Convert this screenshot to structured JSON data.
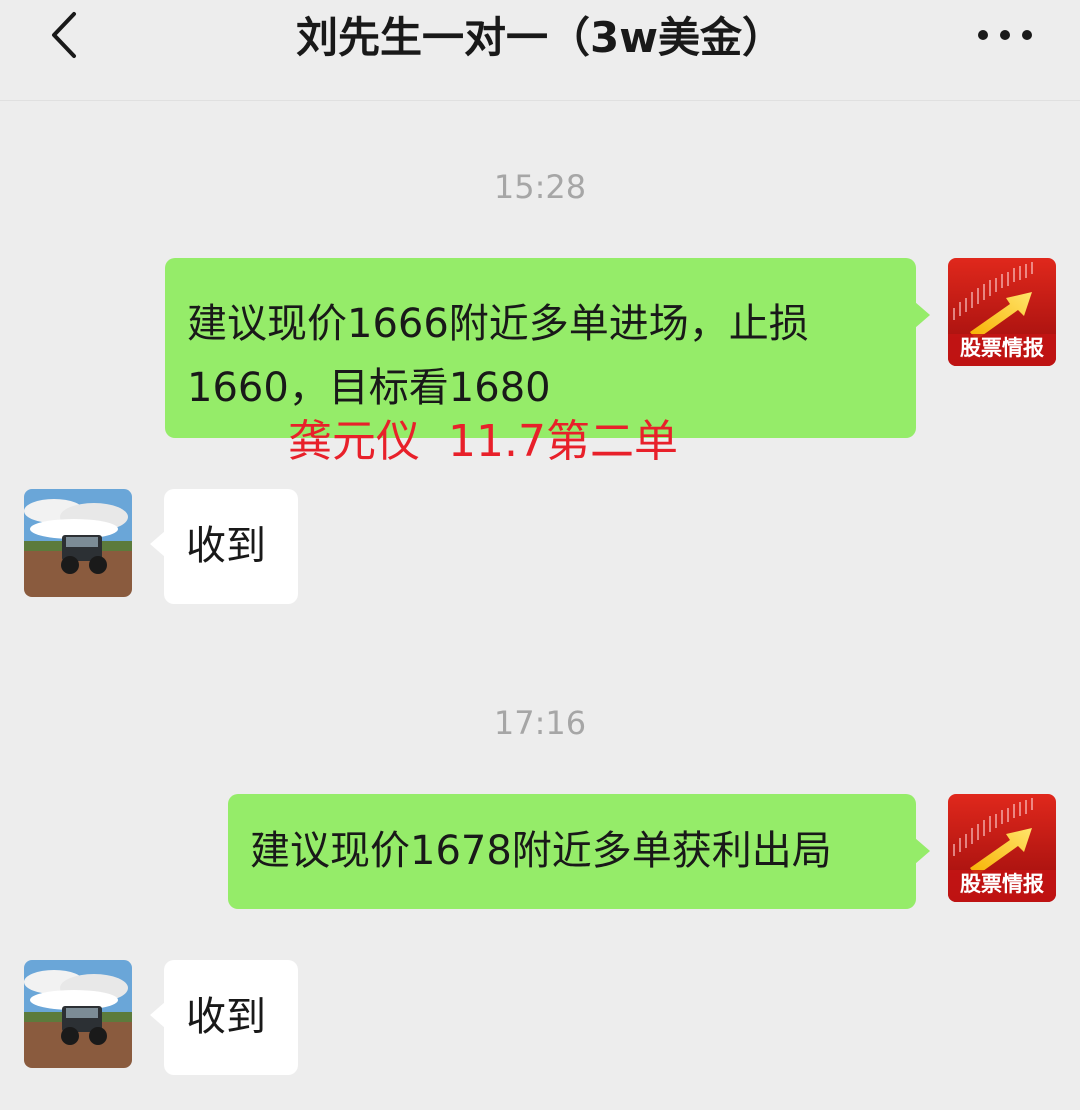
{
  "header": {
    "title": "刘先生一对一（3w美金）",
    "back_icon": "chevron-left-icon",
    "more_icon": "ellipsis-icon"
  },
  "messages": [
    {
      "type": "timestamp",
      "text": "15:28"
    },
    {
      "type": "outgoing",
      "text": "建议现价1666附近多单进场，止损1660，目标看1680",
      "avatar_label": "股票情报"
    },
    {
      "type": "incoming",
      "text": "收到",
      "avatar": "jeep-landscape-photo"
    },
    {
      "type": "timestamp",
      "text": "17:16"
    },
    {
      "type": "outgoing",
      "text": "建议现价1678附近多单获利出局",
      "avatar_label": "股票情报"
    },
    {
      "type": "incoming",
      "text": "收到",
      "avatar": "jeep-landscape-photo"
    }
  ],
  "annotation": {
    "text": "龚元仪  11.7第二单"
  },
  "colors": {
    "background": "#ededed",
    "outgoing_bubble": "#95ec69",
    "incoming_bubble": "#ffffff",
    "annotation": "#e8202a",
    "timestamp": "#a6a6a6"
  }
}
